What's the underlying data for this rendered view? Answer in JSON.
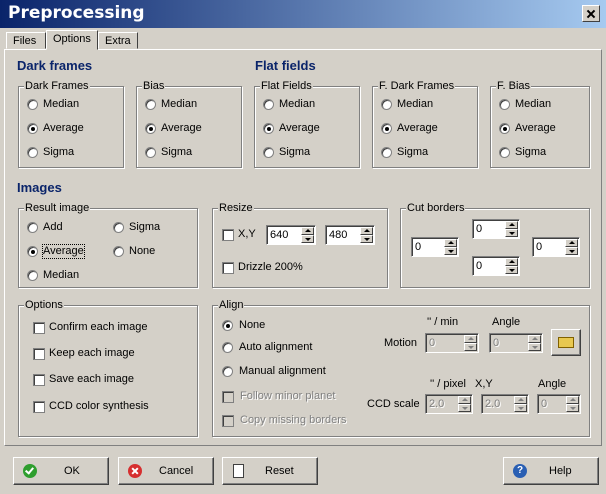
{
  "window": {
    "title": "Preprocessing"
  },
  "tabs": [
    {
      "label": "Files"
    },
    {
      "label": "Options"
    },
    {
      "label": "Extra"
    }
  ],
  "sections": {
    "dark_frames": "Dark frames",
    "flat_fields": "Flat fields",
    "images": "Images"
  },
  "dark_frames_group": {
    "label": "Dark Frames",
    "options": [
      "Median",
      "Average",
      "Sigma"
    ],
    "selected": "Average"
  },
  "bias_group": {
    "label": "Bias",
    "options": [
      "Median",
      "Average",
      "Sigma"
    ],
    "selected": "Average"
  },
  "flat_fields_group": {
    "label": "Flat Fields",
    "options": [
      "Median",
      "Average",
      "Sigma"
    ],
    "selected": "Average"
  },
  "f_dark_frames_group": {
    "label": "F. Dark Frames",
    "options": [
      "Median",
      "Average",
      "Sigma"
    ],
    "selected": "Average"
  },
  "f_bias_group": {
    "label": "F. Bias",
    "options": [
      "Median",
      "Average",
      "Sigma"
    ],
    "selected": "Average"
  },
  "result_image": {
    "label": "Result image",
    "options": [
      "Add",
      "Average",
      "Median",
      "Sigma",
      "None"
    ],
    "selected": "Average"
  },
  "resize": {
    "label": "Resize",
    "xy_label": "X,Y",
    "x_value": "640",
    "y_value": "480",
    "drizzle_label": "Drizzle 200%"
  },
  "cut_borders": {
    "label": "Cut borders",
    "top": "0",
    "left": "0",
    "right": "0",
    "bottom": "0"
  },
  "options_group": {
    "label": "Options",
    "items": [
      "Confirm each image",
      "Keep each image",
      "Save each image",
      "CCD color synthesis"
    ]
  },
  "align": {
    "label": "Align",
    "modes": [
      "None",
      "Auto alignment",
      "Manual alignment"
    ],
    "selected": "None",
    "follow_minor_planet": "Follow minor planet",
    "copy_missing_borders": "Copy missing borders",
    "motion_label": "Motion",
    "motion_unit": "'' / min",
    "angle_label": "Angle",
    "motion_value": "0",
    "motion_angle_value": "0",
    "ccd_scale_label": "CCD scale",
    "pixel_unit": "'' / pixel",
    "xy_label": "X,Y",
    "ccd_angle_label": "Angle",
    "pixel_value": "2.0",
    "xy_value": "2.0",
    "ccd_angle_value": "0"
  },
  "buttons": {
    "ok": "OK",
    "cancel": "Cancel",
    "reset": "Reset",
    "help": "Help"
  }
}
